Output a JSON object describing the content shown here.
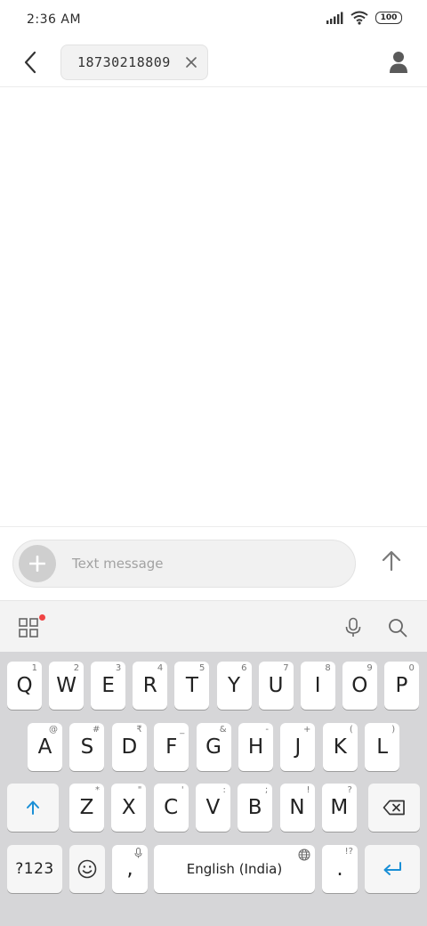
{
  "status_bar": {
    "time": "2:36 AM",
    "battery": "100"
  },
  "header": {
    "recipient": "18730218809"
  },
  "composer": {
    "placeholder": "Text message"
  },
  "keyboard": {
    "row1": [
      {
        "k": "Q",
        "h": "1"
      },
      {
        "k": "W",
        "h": "2"
      },
      {
        "k": "E",
        "h": "3"
      },
      {
        "k": "R",
        "h": "4"
      },
      {
        "k": "T",
        "h": "5"
      },
      {
        "k": "Y",
        "h": "6"
      },
      {
        "k": "U",
        "h": "7"
      },
      {
        "k": "I",
        "h": "8"
      },
      {
        "k": "O",
        "h": "9"
      },
      {
        "k": "P",
        "h": "0"
      }
    ],
    "row2": [
      {
        "k": "A",
        "h": "@"
      },
      {
        "k": "S",
        "h": "#"
      },
      {
        "k": "D",
        "h": "₹"
      },
      {
        "k": "F",
        "h": "_"
      },
      {
        "k": "G",
        "h": "&"
      },
      {
        "k": "H",
        "h": "-"
      },
      {
        "k": "J",
        "h": "+"
      },
      {
        "k": "K",
        "h": "("
      },
      {
        "k": "L",
        "h": ")"
      }
    ],
    "row3": [
      {
        "k": "Z",
        "h": "*"
      },
      {
        "k": "X",
        "h": "\""
      },
      {
        "k": "C",
        "h": "'"
      },
      {
        "k": "V",
        "h": ":"
      },
      {
        "k": "B",
        "h": ";"
      },
      {
        "k": "N",
        "h": "!"
      },
      {
        "k": "M",
        "h": "?"
      }
    ],
    "symbols_label": "?123",
    "comma": ",",
    "space_label": "English (India)",
    "period": ".",
    "period_hint": "!?"
  },
  "colors": {
    "accent": "#1a8fd6",
    "notification_dot": "#f04444"
  }
}
